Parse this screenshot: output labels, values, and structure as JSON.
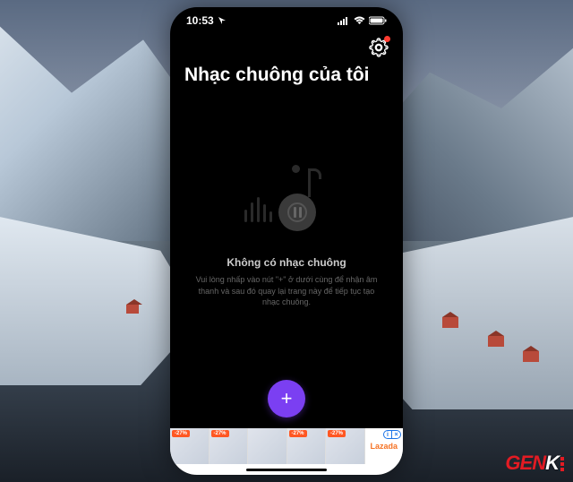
{
  "statusBar": {
    "time": "10:53",
    "locationIcon": "◀"
  },
  "header": {
    "title": "Nhạc chuông của tôi"
  },
  "emptyState": {
    "title": "Không có nhạc chuông",
    "description": "Vui lòng nhấp vào nút \"+\" ở dưới cùng để nhận âm thanh và sau đó quay lại trang này để tiếp tục tạo nhạc chuông."
  },
  "fab": {
    "label": "+"
  },
  "adBanner": {
    "items": [
      {
        "discount": "-27%"
      },
      {
        "discount": "-27%"
      },
      {
        "discount": ""
      },
      {
        "discount": "-27%"
      },
      {
        "discount": "-27%"
      }
    ],
    "brand": "Lazada"
  },
  "watermark": {
    "text1": "GEN",
    "text2": "K"
  }
}
